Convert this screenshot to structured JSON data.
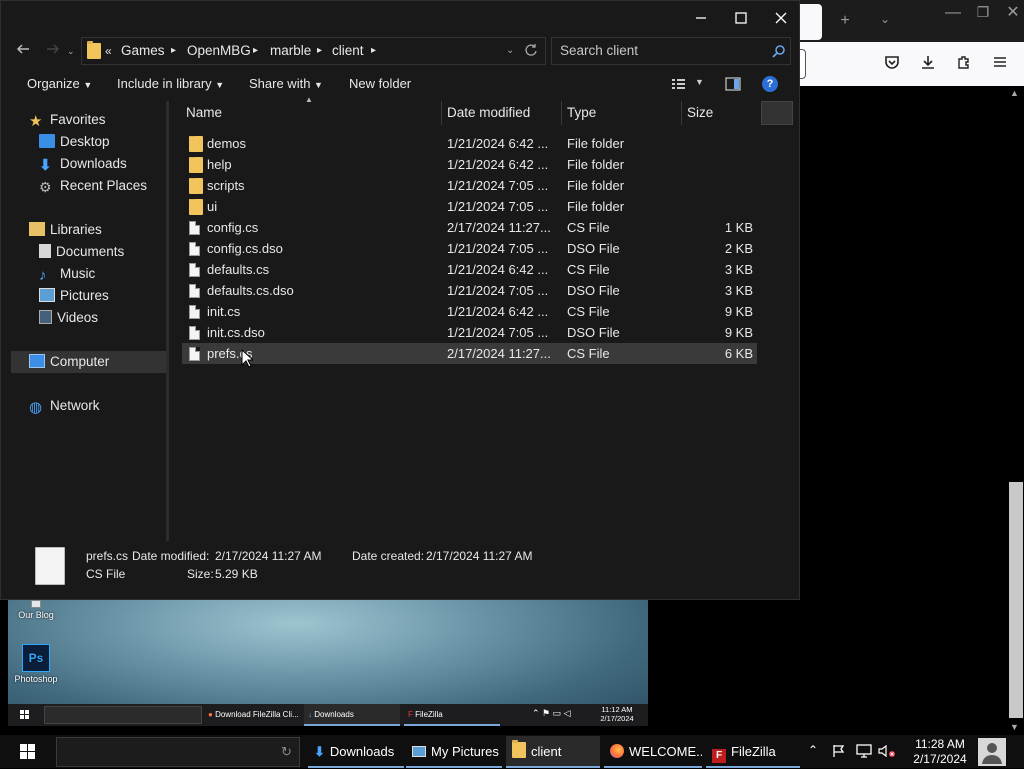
{
  "explorer": {
    "breadcrumb": [
      "Games",
      "OpenMBG",
      "marble",
      "client"
    ],
    "search_placeholder": "Search client",
    "toolbar": {
      "organize": "Organize",
      "include_in_library": "Include in library",
      "share_with": "Share with",
      "new_folder": "New folder"
    },
    "nav": {
      "favorites": "Favorites",
      "desktop": "Desktop",
      "downloads": "Downloads",
      "recent_places": "Recent Places",
      "libraries": "Libraries",
      "documents": "Documents",
      "music": "Music",
      "pictures": "Pictures",
      "videos": "Videos",
      "computer": "Computer",
      "network": "Network"
    },
    "columns": {
      "name": "Name",
      "date_modified": "Date modified",
      "type": "Type",
      "size": "Size"
    },
    "files": [
      {
        "name": "demos",
        "date": "1/21/2024 6:42 ...",
        "type": "File folder",
        "size": "",
        "kind": "folder"
      },
      {
        "name": "help",
        "date": "1/21/2024 6:42 ...",
        "type": "File folder",
        "size": "",
        "kind": "folder"
      },
      {
        "name": "scripts",
        "date": "1/21/2024 7:05 ...",
        "type": "File folder",
        "size": "",
        "kind": "folder"
      },
      {
        "name": "ui",
        "date": "1/21/2024 7:05 ...",
        "type": "File folder",
        "size": "",
        "kind": "folder"
      },
      {
        "name": "config.cs",
        "date": "2/17/2024 11:27...",
        "type": "CS File",
        "size": "1 KB",
        "kind": "file"
      },
      {
        "name": "config.cs.dso",
        "date": "1/21/2024 7:05 ...",
        "type": "DSO File",
        "size": "2 KB",
        "kind": "file"
      },
      {
        "name": "defaults.cs",
        "date": "1/21/2024 6:42 ...",
        "type": "CS File",
        "size": "3 KB",
        "kind": "file"
      },
      {
        "name": "defaults.cs.dso",
        "date": "1/21/2024 7:05 ...",
        "type": "DSO File",
        "size": "3 KB",
        "kind": "file"
      },
      {
        "name": "init.cs",
        "date": "1/21/2024 6:42 ...",
        "type": "CS File",
        "size": "9 KB",
        "kind": "file"
      },
      {
        "name": "init.cs.dso",
        "date": "1/21/2024 7:05 ...",
        "type": "DSO File",
        "size": "9 KB",
        "kind": "file"
      },
      {
        "name": "prefs.cs",
        "date": "2/17/2024 11:27...",
        "type": "CS File",
        "size": "6 KB",
        "kind": "file"
      }
    ],
    "selected_index": 10,
    "details": {
      "filename": "prefs.cs",
      "modified_label": "Date modified:",
      "modified_value": "2/17/2024 11:27 AM",
      "created_label": "Date created:",
      "created_value": "2/17/2024 11:27 AM",
      "type": "CS File",
      "size_label": "Size:",
      "size_value": "5.29 KB"
    }
  },
  "inner_desktop": {
    "icon_our_blog": "Our Blog",
    "icon_photoshop": "Photoshop",
    "taskbar": [
      "Download FileZilla Cli...",
      "Downloads",
      "FileZilla"
    ],
    "clock_time": "11:12 AM",
    "clock_date": "2/17/2024"
  },
  "taskbar": {
    "items": [
      "Downloads",
      "My Pictures",
      "client",
      "WELCOME...",
      "FileZilla"
    ],
    "active_index": 2,
    "clock_time": "11:28 AM",
    "clock_date": "2/17/2024"
  },
  "colors": {
    "explorer_bg": "#191919",
    "selection": "#3a3a3a",
    "folder": "#f2c55c",
    "accent": "#7aa7d8"
  }
}
